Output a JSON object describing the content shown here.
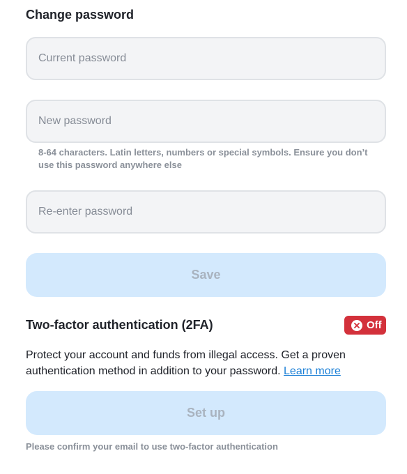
{
  "change_password": {
    "title": "Change password",
    "current_password_placeholder": "Current password",
    "new_password_placeholder": "New password",
    "hint": "8-64 characters. Latin letters, numbers or special symbols. Ensure you don’t use this password anywhere else",
    "reenter_password_placeholder": "Re-enter password",
    "save_label": "Save"
  },
  "two_factor": {
    "title": "Two-factor authentication (2FA)",
    "status_label": "Off",
    "status_icon": "close-circle-icon",
    "status_color": "#d3313b",
    "description": "Protect your account and funds from illegal access. Get a proven authentication method in addition to your password.",
    "learn_more_label": "Learn more",
    "setup_label": "Set up",
    "confirm_note": "Please confirm your email to use two-factor authentication"
  },
  "colors": {
    "accent_link": "#1a7fd6",
    "disabled_button_bg": "#d3e9fd",
    "input_bg": "#f3f4f6"
  }
}
